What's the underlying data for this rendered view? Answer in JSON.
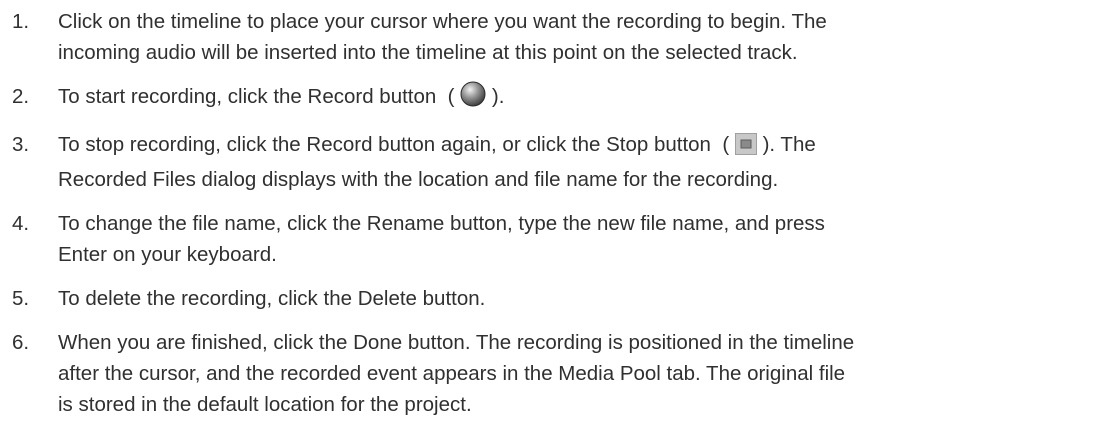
{
  "steps": [
    {
      "num": "1.",
      "lines": [
        "Click on the timeline to place your cursor where you want the recording to begin. The",
        "incoming audio will be inserted into the timeline at this point on the selected track."
      ]
    },
    {
      "num": "2.",
      "before_icon": "To start recording, click the Record button  (",
      "icon": "record-button-icon",
      "after_icon": ")."
    },
    {
      "num": "3.",
      "before_icon": "To stop recording, click the Record button again, or click the Stop button  (",
      "icon": "stop-button-icon",
      "after_icon": "). The",
      "lines_after": [
        "Recorded Files dialog displays with the location and file name for the recording."
      ]
    },
    {
      "num": "4.",
      "lines": [
        "To change the file name, click the Rename button, type the new file name, and press",
        "Enter on your keyboard."
      ]
    },
    {
      "num": "5.",
      "lines": [
        "To delete the recording, click the Delete button."
      ]
    },
    {
      "num": "6.",
      "lines": [
        "When you are finished, click the Done button. The recording is positioned in the timeline",
        "after the cursor, and the recorded event appears in the Media Pool tab. The original file",
        "is stored in the default location for the project."
      ]
    }
  ]
}
